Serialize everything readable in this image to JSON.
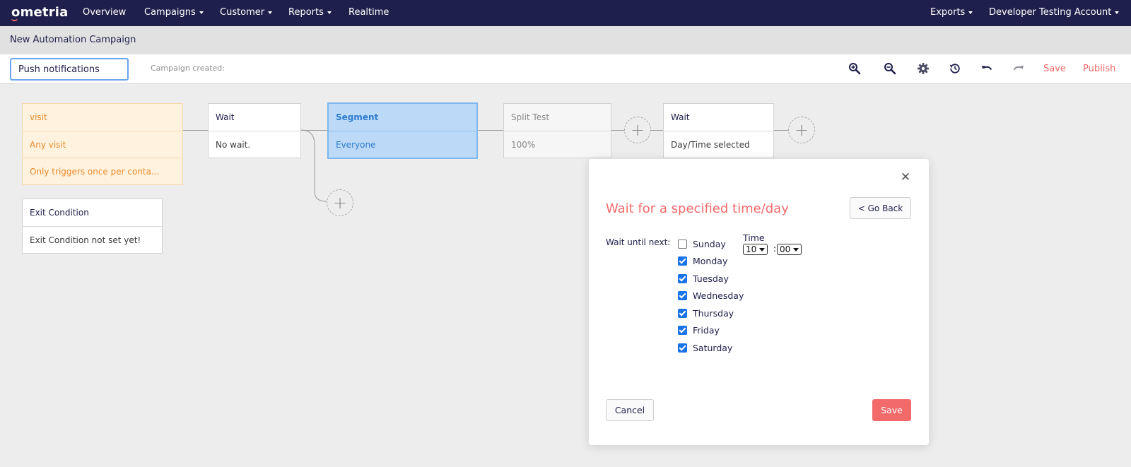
{
  "brand": {
    "logo": "ometria",
    "accent": "#f26a6a",
    "nav_bg": "#1f1f4c"
  },
  "nav": {
    "overview": "Overview",
    "campaigns": "Campaigns",
    "customer": "Customer",
    "reports": "Reports",
    "realtime": "Realtime",
    "exports": "Exports",
    "account": "Developer Testing Account"
  },
  "page": {
    "title": "New Automation Campaign"
  },
  "toolbar": {
    "campaign_name": "Push notifications",
    "created_label": "Campaign created:",
    "save": "Save",
    "publish": "Publish",
    "icons": [
      "zoom-in-icon",
      "zoom-out-icon",
      "gear-icon",
      "history-icon",
      "undo-icon",
      "redo-icon"
    ]
  },
  "flow": {
    "trigger": {
      "title": "visit",
      "event": "Any visit",
      "rule": "Only triggers once per conta..."
    },
    "exit": {
      "title": "Exit Condition",
      "value": "Exit Condition not set yet!"
    },
    "wait1": {
      "title": "Wait",
      "value": "No wait."
    },
    "segment": {
      "title": "Segment",
      "value": "Everyone"
    },
    "split": {
      "title": "Split Test",
      "value": "100%"
    },
    "wait2": {
      "title": "Wait",
      "value": "Day/Time selected"
    }
  },
  "modal": {
    "title": "Wait for a specified time/day",
    "go_back": "< Go Back",
    "wait_label": "Wait until next:",
    "days": [
      {
        "label": "Sunday",
        "checked": false
      },
      {
        "label": "Monday",
        "checked": true
      },
      {
        "label": "Tuesday",
        "checked": true
      },
      {
        "label": "Wednesday",
        "checked": true
      },
      {
        "label": "Thursday",
        "checked": true
      },
      {
        "label": "Friday",
        "checked": true
      },
      {
        "label": "Saturday",
        "checked": true
      }
    ],
    "time_label": "Time",
    "hour": "10",
    "minute": "00",
    "separator": ":",
    "cancel": "Cancel",
    "save": "Save"
  }
}
